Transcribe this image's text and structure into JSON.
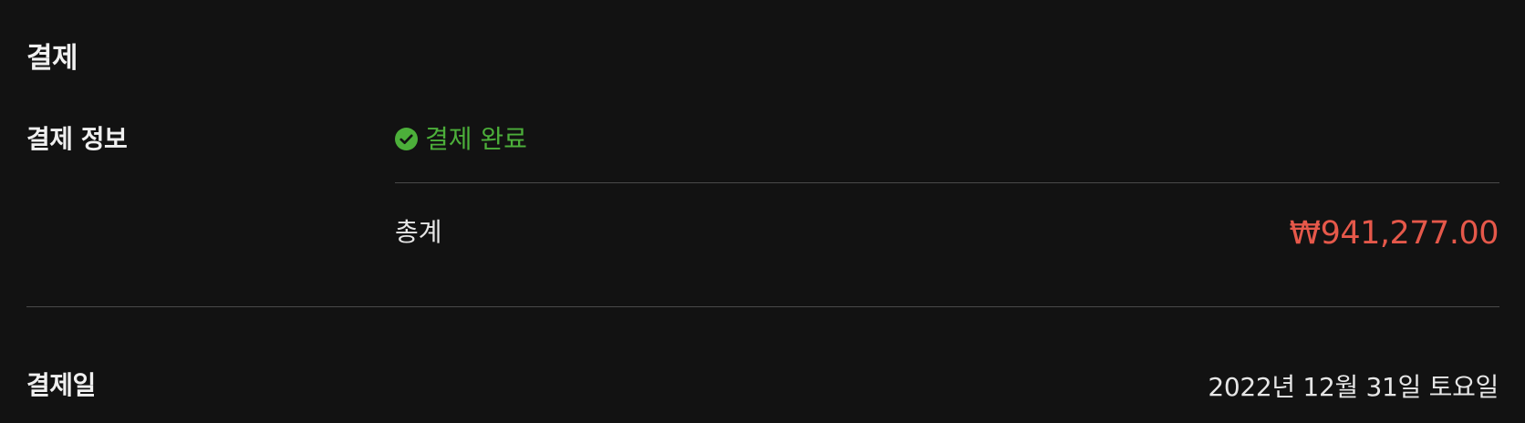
{
  "section": {
    "title": "결제"
  },
  "payment_info": {
    "label": "결제 정보",
    "status_icon": "check-circle-icon",
    "status_text": "결제 완료",
    "status_color": "#4caf3a",
    "total_label": "총계",
    "total_value": "₩941,277.00",
    "total_color": "#e5584a"
  },
  "payment_date": {
    "label": "결제일",
    "value": "2022년 12월 31일 토요일"
  }
}
